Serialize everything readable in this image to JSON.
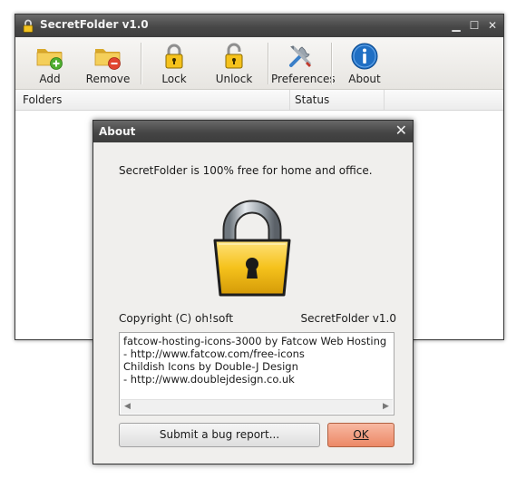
{
  "main_window": {
    "title": "SecretFolder v1.0",
    "controls": {
      "minimize": "▁",
      "maximize": "☐",
      "close": "✕"
    },
    "toolbar": [
      {
        "id": "add",
        "label": "Add",
        "icon": "folder-add-icon"
      },
      {
        "id": "remove",
        "label": "Remove",
        "icon": "folder-remove-icon"
      },
      {
        "id": "lock",
        "label": "Lock",
        "icon": "lock-icon"
      },
      {
        "id": "unlock",
        "label": "Unlock",
        "icon": "unlock-icon"
      },
      {
        "id": "preferences",
        "label": "Preferences",
        "icon": "tools-icon"
      },
      {
        "id": "about",
        "label": "About",
        "icon": "info-icon"
      }
    ],
    "columns": [
      "Folders",
      "Status"
    ]
  },
  "about_dialog": {
    "title": "About",
    "close": "✕",
    "intro": "SecretFolder is 100% free for home and office.",
    "copyright": "Copyright (C) oh!soft",
    "version": "SecretFolder v1.0",
    "credits": [
      "fatcow-hosting-icons-3000 by Fatcow Web Hosting",
      "- http://www.fatcow.com/free-icons",
      "Childish Icons by Double-J Design",
      "- http://www.doublejdesign.co.uk"
    ],
    "bug_button": "Submit a bug report...",
    "ok_button": "OK"
  },
  "colors": {
    "titlebar": "#474747",
    "folder": "#f2c84b",
    "lock_body": "#f5c21c",
    "ok_accent": "#ec8866",
    "info_blue": "#1f6fc4"
  }
}
